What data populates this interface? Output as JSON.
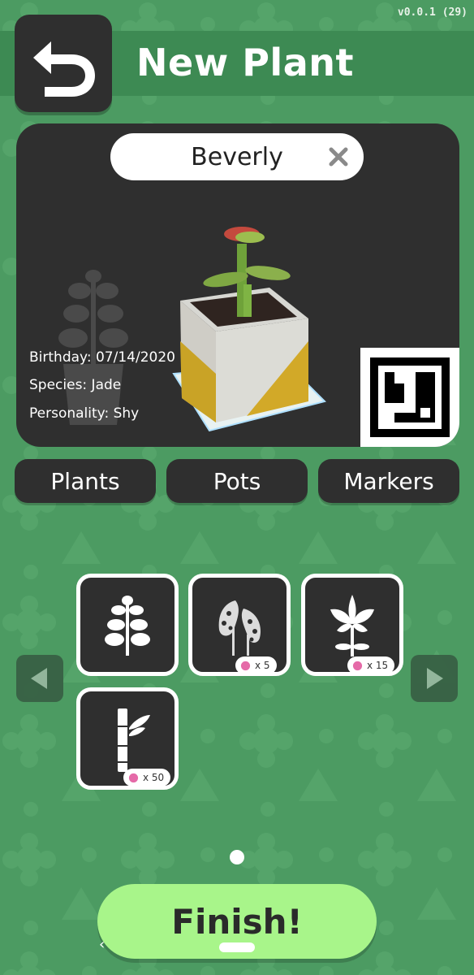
{
  "version": "v0.0.1 (29)",
  "header": {
    "title": "New Plant",
    "back_icon": "back-arrow-icon"
  },
  "preview": {
    "name_value": "Beverly",
    "clear_icon": "close-icon",
    "info": {
      "birthday": "Birthday: 07/14/2020",
      "species": "Species: Jade",
      "personality": "Personality: Shy"
    }
  },
  "tabs": [
    {
      "label": "Plants"
    },
    {
      "label": "Pots"
    },
    {
      "label": "Markers"
    }
  ],
  "items": [
    {
      "icon": "jade-plant-icon",
      "cost": ""
    },
    {
      "icon": "leafy-plant-icon",
      "cost": "x 5"
    },
    {
      "icon": "lily-flower-icon",
      "cost": "x 15"
    },
    {
      "icon": "bamboo-icon",
      "cost": "x 50"
    }
  ],
  "finish_label": "Finish!",
  "colors": {
    "background": "#4c9b62",
    "header_band": "#3d8a53",
    "panel": "#2f2f2f",
    "finish": "#a8f58a",
    "currency": "#e56aa8"
  }
}
